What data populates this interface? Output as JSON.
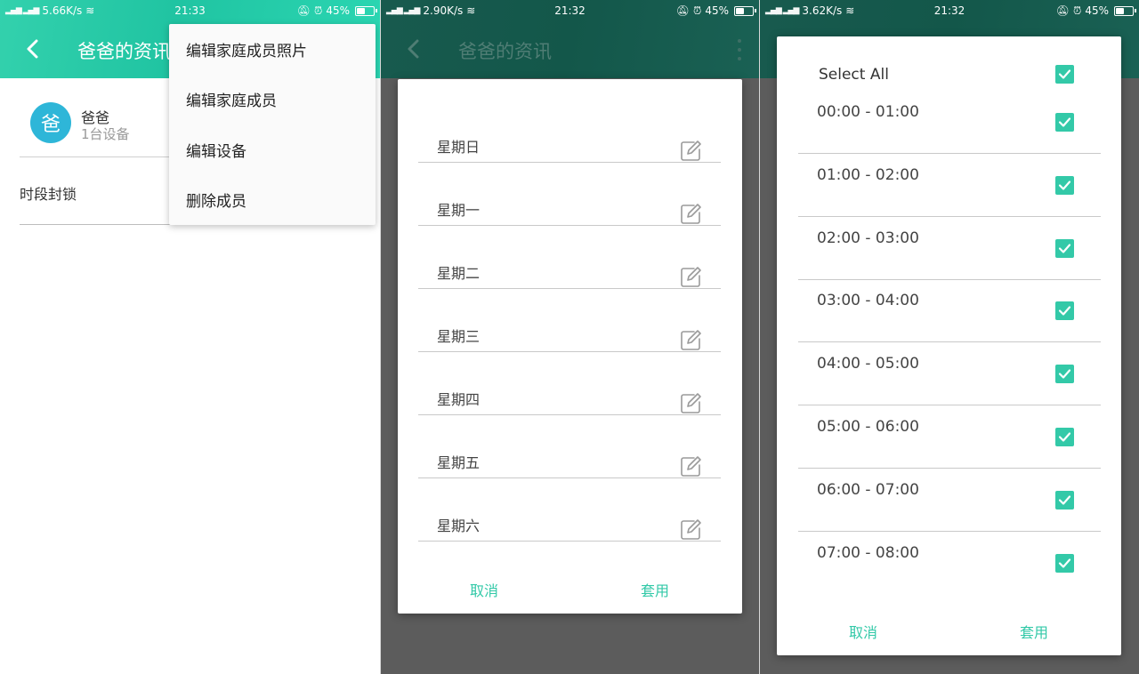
{
  "screen1": {
    "status": {
      "signal": "4G",
      "speed": "5.66K/s",
      "time": "21:33",
      "battery": "45%",
      "battery_level": 0.45
    },
    "title": "爸爸的资讯",
    "member": {
      "avatar_text": "爸",
      "name": "爸爸",
      "devices": "1台设备"
    },
    "schedule_label": "时段封锁",
    "menu": [
      {
        "label": "编辑家庭成员照片"
      },
      {
        "label": "编辑家庭成员"
      },
      {
        "label": "编辑设备"
      },
      {
        "label": "删除成员"
      }
    ]
  },
  "screen2": {
    "status": {
      "signal": "4G",
      "speed": "2.90K/s",
      "time": "21:32",
      "battery": "45%",
      "battery_level": 0.45
    },
    "title": "爸爸的资讯",
    "days": [
      {
        "label": "星期日"
      },
      {
        "label": "星期一"
      },
      {
        "label": "星期二"
      },
      {
        "label": "星期三"
      },
      {
        "label": "星期四"
      },
      {
        "label": "星期五"
      },
      {
        "label": "星期六"
      }
    ],
    "cancel_label": "取消",
    "apply_label": "套用"
  },
  "screen3": {
    "status": {
      "signal": "4G",
      "speed": "3.62K/s",
      "time": "21:32",
      "battery": "45%",
      "battery_level": 0.45
    },
    "select_all_label": "Select All",
    "select_all_checked": true,
    "hours": [
      {
        "label": "00:00 - 01:00",
        "checked": true
      },
      {
        "label": "01:00 - 02:00",
        "checked": true
      },
      {
        "label": "02:00 - 03:00",
        "checked": true
      },
      {
        "label": "03:00 - 04:00",
        "checked": true
      },
      {
        "label": "04:00 - 05:00",
        "checked": true
      },
      {
        "label": "05:00 - 06:00",
        "checked": true
      },
      {
        "label": "06:00 - 07:00",
        "checked": true
      },
      {
        "label": "07:00 - 08:00",
        "checked": true
      }
    ],
    "cancel_label": "取消",
    "apply_label": "套用"
  },
  "colors": {
    "accent": "#33c9a8",
    "avatar": "#2eb6d8",
    "appbar": "#20c4a2"
  }
}
